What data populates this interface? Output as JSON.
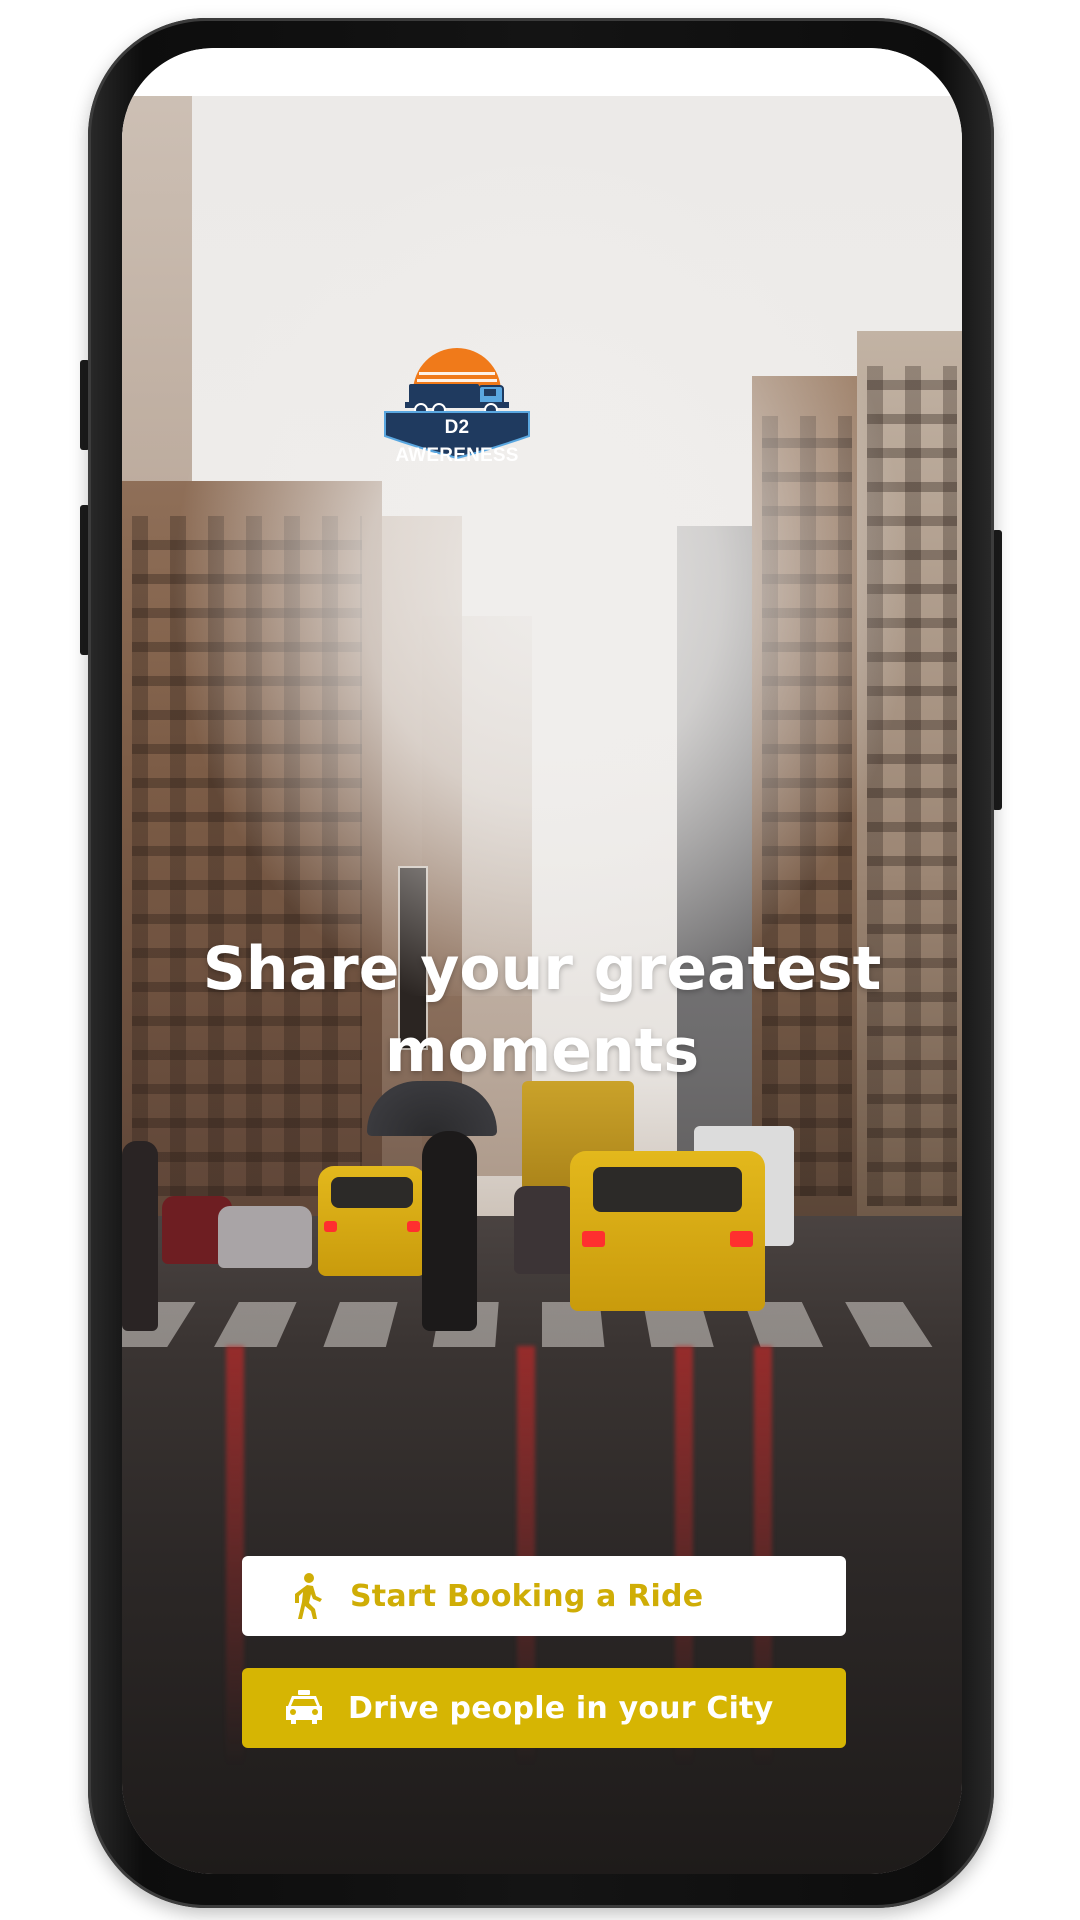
{
  "app": {
    "logo_text": "D2 AWERENESS"
  },
  "hero": {
    "headline": "Share your greatest moments"
  },
  "actions": {
    "ride_label": "Start Booking a Ride",
    "ride_icon": "walking-person-icon",
    "drive_label": "Drive people in your City",
    "drive_icon": "car-icon"
  },
  "colors": {
    "accent": "#d6b503",
    "logo_orange": "#f07a1a",
    "logo_navy": "#1f3a5f",
    "logo_truck_blue": "#5aa7e0"
  }
}
